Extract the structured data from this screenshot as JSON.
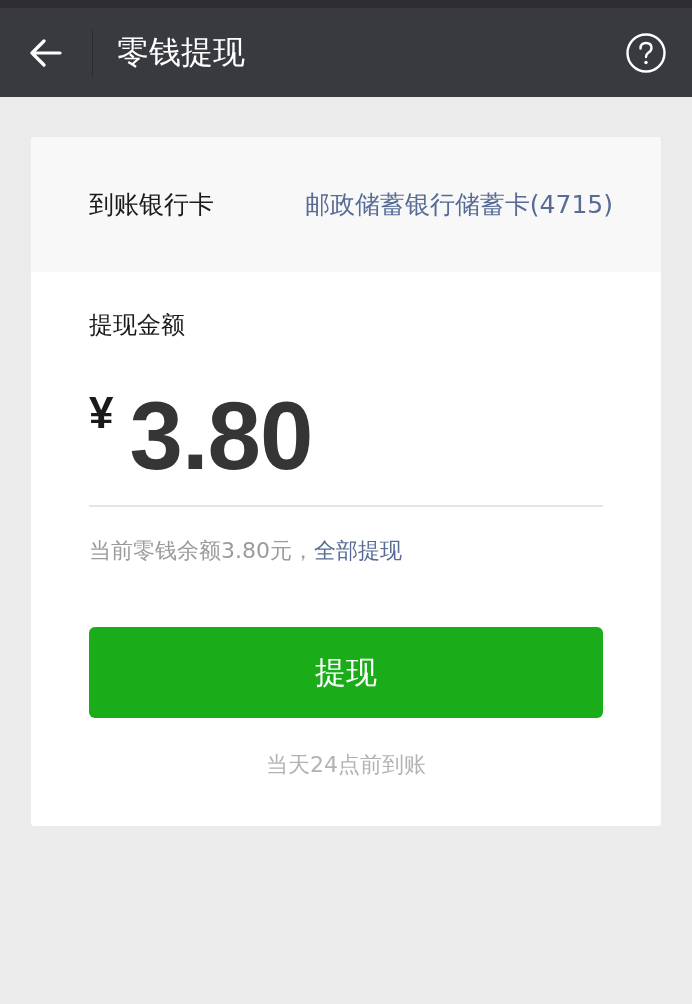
{
  "header": {
    "title": "零钱提现"
  },
  "bank_card": {
    "label": "到账银行卡",
    "value": "邮政储蓄银行储蓄卡(4715)"
  },
  "amount": {
    "label": "提现金额",
    "currency": "¥",
    "value": "3.80"
  },
  "balance": {
    "text": "当前零钱余额3.80元，",
    "link": "全部提现"
  },
  "submit_button": {
    "label": "提现"
  },
  "note": "当天24点前到账"
}
